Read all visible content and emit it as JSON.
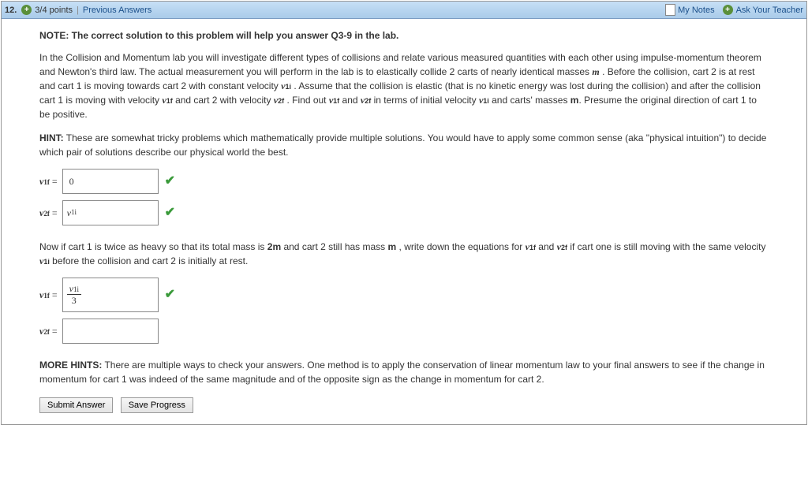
{
  "header": {
    "qnum": "12.",
    "points": "3/4 points",
    "prev": "Previous Answers",
    "notes": "My Notes",
    "ask": "Ask Your Teacher"
  },
  "body": {
    "note": "NOTE: The correct solution to this problem will help you answer Q3-9 in the lab.",
    "p1a": "In the Collision and Momentum lab you will investigate different types of collisions and relate various measured quantities with each other using impulse-momentum theorem and Newton's third law. The actual measurement you will perform in the lab is to elastically collide 2 carts of nearly identical masses ",
    "m": "m",
    "p1b": " . Before the collision, cart 2 is at rest and cart 1 is moving towards cart 2 with constant velocity ",
    "v1i": "v",
    "v1i_sub": "1i",
    "p1c": " . Assume that the collision is elastic (that is no kinetic energy was lost during the collision) and after the collision cart 1 is moving with velocity ",
    "v1f": "v",
    "v1f_sub": "1f",
    "p1d": " and cart 2 with velocity ",
    "v2f": "v",
    "v2f_sub": "2f",
    "p1e": " . Find out ",
    "p1f": " and ",
    "p1g": " in terms of initial velocity ",
    "p1h": " and carts' masses ",
    "mb": "m",
    "p1i": ". Presume the original direction of cart 1 to be positive.",
    "hint_lbl": "HINT:",
    "hint": " These are somewhat tricky problems which mathematically provide multiple solutions. You would have to apply some common sense (aka \"physical intuition\") to decide which pair of solutions describe our physical world the best.",
    "ans1_lbl_v": "v",
    "ans1_lbl_s": "1f",
    "eq": " = ",
    "ans1_val": "0",
    "ans2_lbl_v": "v",
    "ans2_lbl_s": "2f",
    "ans2_val_v": "v",
    "ans2_val_s": "1i",
    "p2a": "Now if cart 1 is twice as heavy so that its total mass is ",
    "twom": "2m",
    "p2b": " and cart 2 still has mass ",
    "p2c": " , write down the equations for ",
    "p2d": " if cart one is still moving with the same velocity ",
    "p2e": " before the collision and cart 2 is initially at rest.",
    "ans3_num_v": "v",
    "ans3_num_s": "1i",
    "ans3_den": "3",
    "more_lbl": "MORE HINTS:",
    "more": " There are multiple ways to check your answers. One method is to apply the conservation of linear momentum law to your final answers to see if the change in momentum for cart 1 was indeed of the same magnitude and of the opposite sign as the change in momentum for cart 2.",
    "btn_submit": "Submit Answer",
    "btn_save": "Save Progress"
  }
}
